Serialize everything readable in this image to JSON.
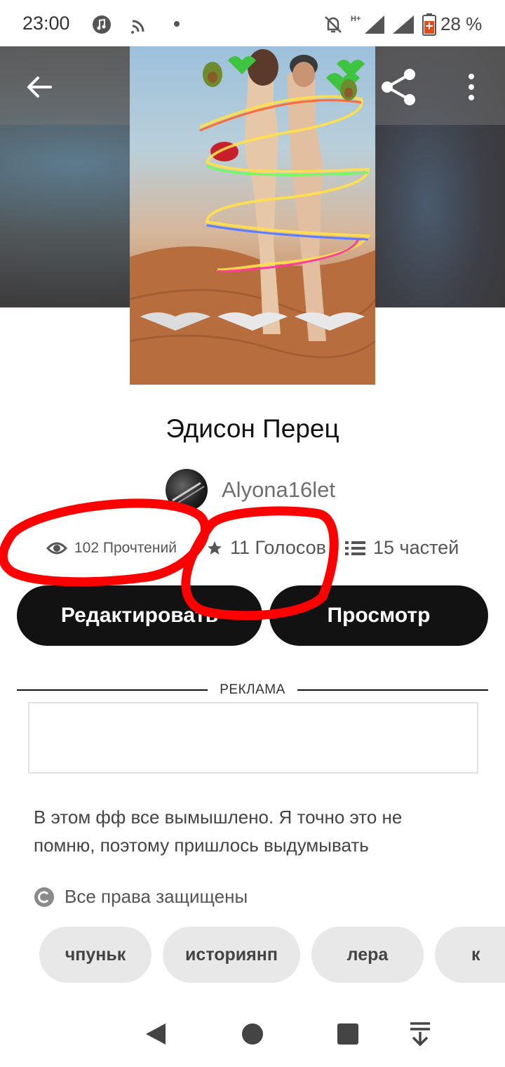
{
  "status_bar": {
    "time": "23:00",
    "battery": "28 %",
    "icons": [
      "music-icon",
      "cast-icon",
      "dot-icon",
      "bell-off-icon",
      "signal-icon",
      "signal-icon",
      "battery-icon"
    ]
  },
  "header": {
    "back_icon": "arrow-left-icon",
    "share_icon": "share-icon",
    "more_icon": "more-vertical-icon"
  },
  "story": {
    "title": "Эдисон Перец",
    "author": "Alyona16let",
    "reads": "102 Прочтений",
    "votes": "11 Голосов",
    "parts": "15 частей"
  },
  "buttons": {
    "edit": "Редактировать",
    "view": "Просмотр"
  },
  "ad": {
    "label": "РЕКЛАМА"
  },
  "description": "В этом фф все вымышлено. Я точно это не помню, поэтому пришлось выдумывать",
  "copyright": "Все права защищены",
  "tags": [
    "чпуньк",
    "историянп",
    "лера",
    "к"
  ],
  "colors": {
    "button_bg": "#121212",
    "tag_bg": "#e8e8e8",
    "annotation": "#ff0000"
  }
}
